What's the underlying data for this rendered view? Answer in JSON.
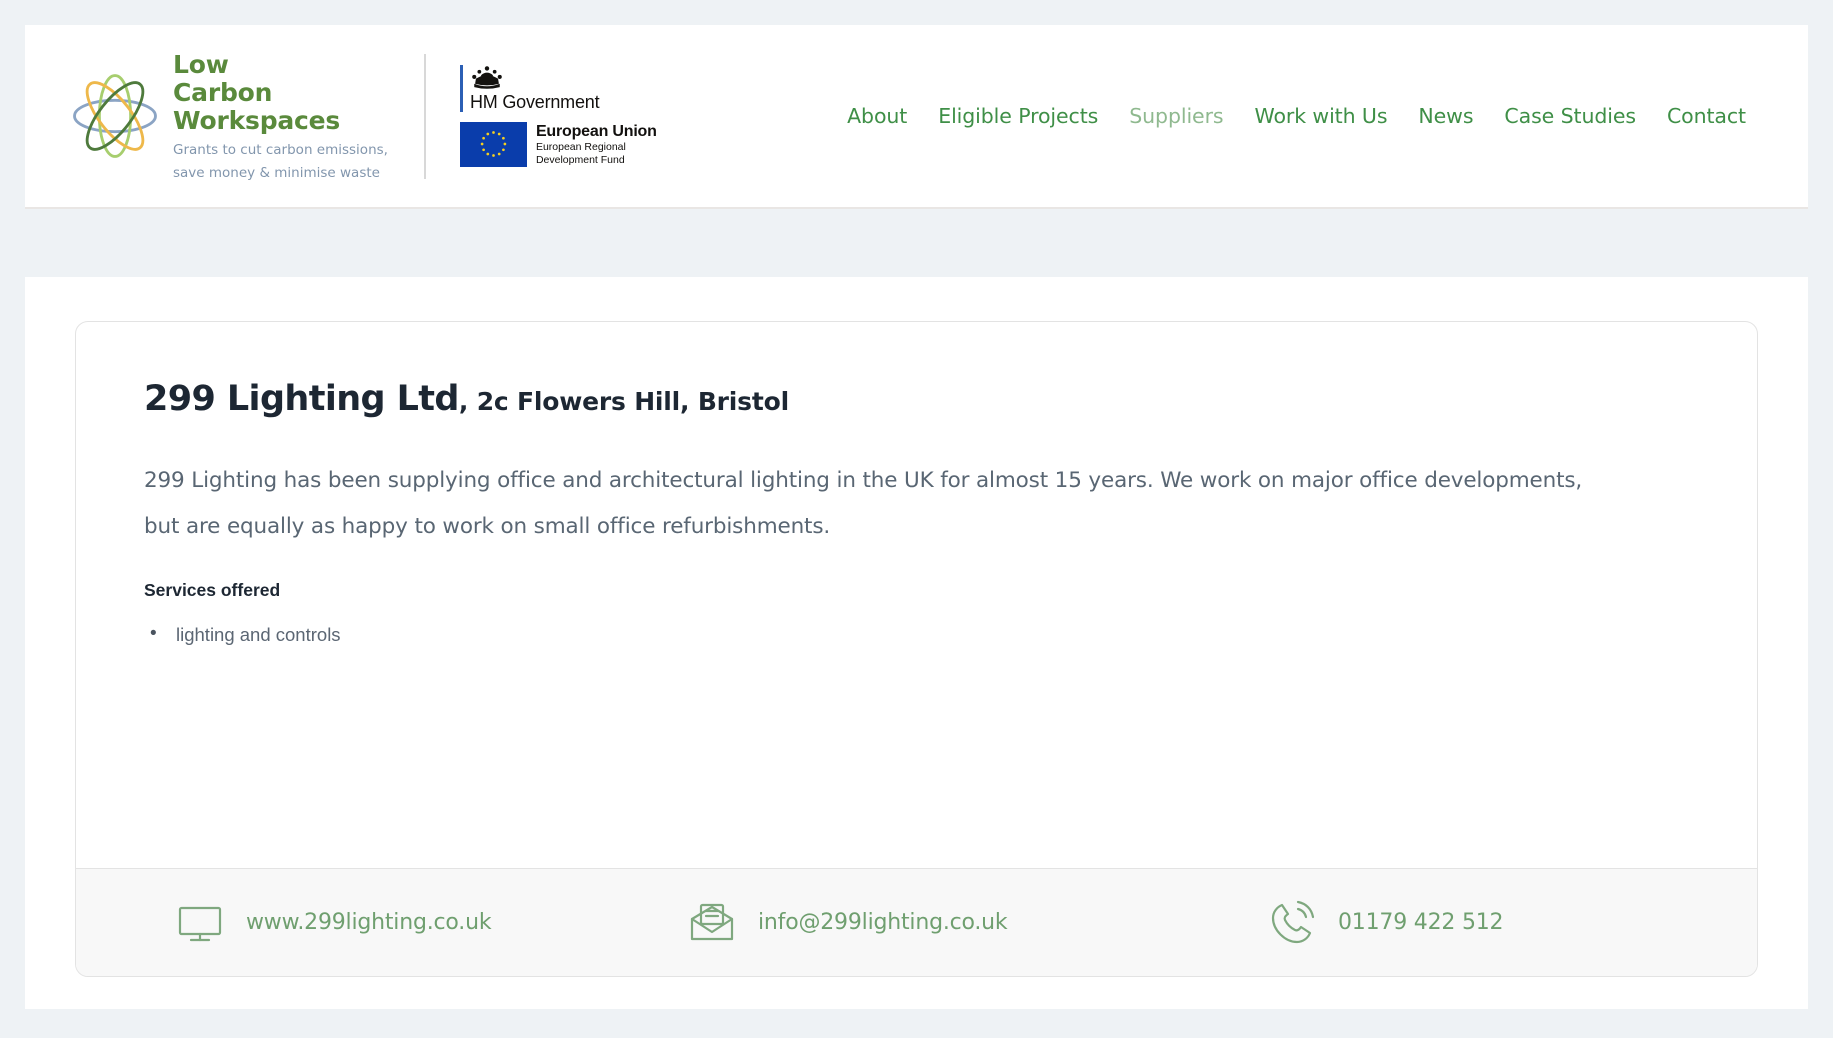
{
  "brand": {
    "logo_icon": "atom-icon",
    "name_lines": [
      "Low",
      "Carbon",
      "Workspaces"
    ],
    "tagline_lines": [
      "Grants to cut carbon emissions,",
      "save money & minimise waste"
    ],
    "accent_green": "#5a8a3c",
    "tagline_color": "#8296ad"
  },
  "gov_logos": {
    "hm_government": {
      "icon": "royal-crown-icon",
      "label": "HM Government",
      "bar_color": "#2b5fb5"
    },
    "european_union": {
      "icon": "eu-flag-icon",
      "title": "European Union",
      "subtitle_lines": [
        "European Regional",
        "Development Fund"
      ],
      "flag_color": "#0a3dab",
      "star_color": "#f5d020"
    }
  },
  "nav": {
    "items": [
      {
        "label": "About",
        "current": false
      },
      {
        "label": "Eligible Projects",
        "current": false
      },
      {
        "label": "Suppliers",
        "current": true
      },
      {
        "label": "Work with Us",
        "current": false
      },
      {
        "label": "News",
        "current": false
      },
      {
        "label": "Case Studies",
        "current": false
      },
      {
        "label": "Contact",
        "current": false
      }
    ],
    "link_color": "#3f8f47",
    "current_color": "#8fb98f"
  },
  "supplier": {
    "name": "299 Lighting Ltd",
    "address": ", 2c Flowers Hill, Bristol",
    "description": "299 Lighting has been supplying office and architectural lighting in the UK for almost 15 years. We work on major office developments, but are equally as happy to work on small office refurbishments.",
    "services_heading": "Services offered",
    "services": [
      "lighting and controls"
    ],
    "contacts": [
      {
        "icon": "monitor-icon",
        "type": "website",
        "label": "www.299lighting.co.uk"
      },
      {
        "icon": "envelope-icon",
        "type": "email",
        "label": "info@299lighting.co.uk"
      },
      {
        "icon": "phone-icon",
        "type": "phone",
        "label": "01179 422 512"
      }
    ],
    "contact_color": "#6f9f6f"
  },
  "theme": {
    "page_background": "#eef2f5",
    "surface": "#ffffff",
    "footer_background": "#f8f8f8",
    "border": "#e3e3e3",
    "heading_color": "#1d2733",
    "body_text_color": "#596673"
  }
}
